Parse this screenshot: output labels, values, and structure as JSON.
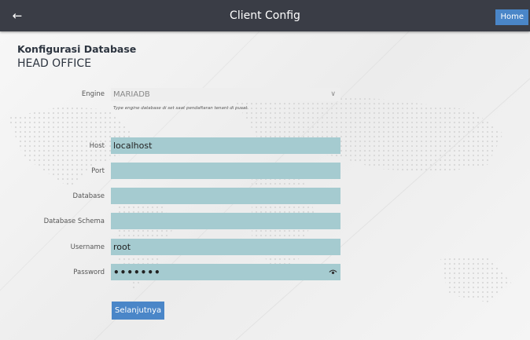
{
  "topbar": {
    "title": "Client Config",
    "back_icon": "arrow-left-icon",
    "home_label": "Home"
  },
  "heading": {
    "title": "Konfigurasi Database",
    "subtitle": "HEAD OFFICE"
  },
  "form": {
    "engine": {
      "label": "Engine",
      "value": "MARIADB",
      "hint": "Type engine database di set saat pendaftaran tenant di pusat."
    },
    "host": {
      "label": "Host",
      "value": "localhost"
    },
    "port": {
      "label": "Port",
      "value": ""
    },
    "database": {
      "label": "Database",
      "value": ""
    },
    "schema": {
      "label": "Database Schema",
      "value": ""
    },
    "username": {
      "label": "Username",
      "value": "root"
    },
    "password": {
      "label": "Password",
      "value": "•••••••"
    },
    "next_label": "Selanjutnya"
  },
  "colors": {
    "topbar": "#3a3d46",
    "accent": "#4a86c8",
    "field": "#a5cbd0"
  }
}
